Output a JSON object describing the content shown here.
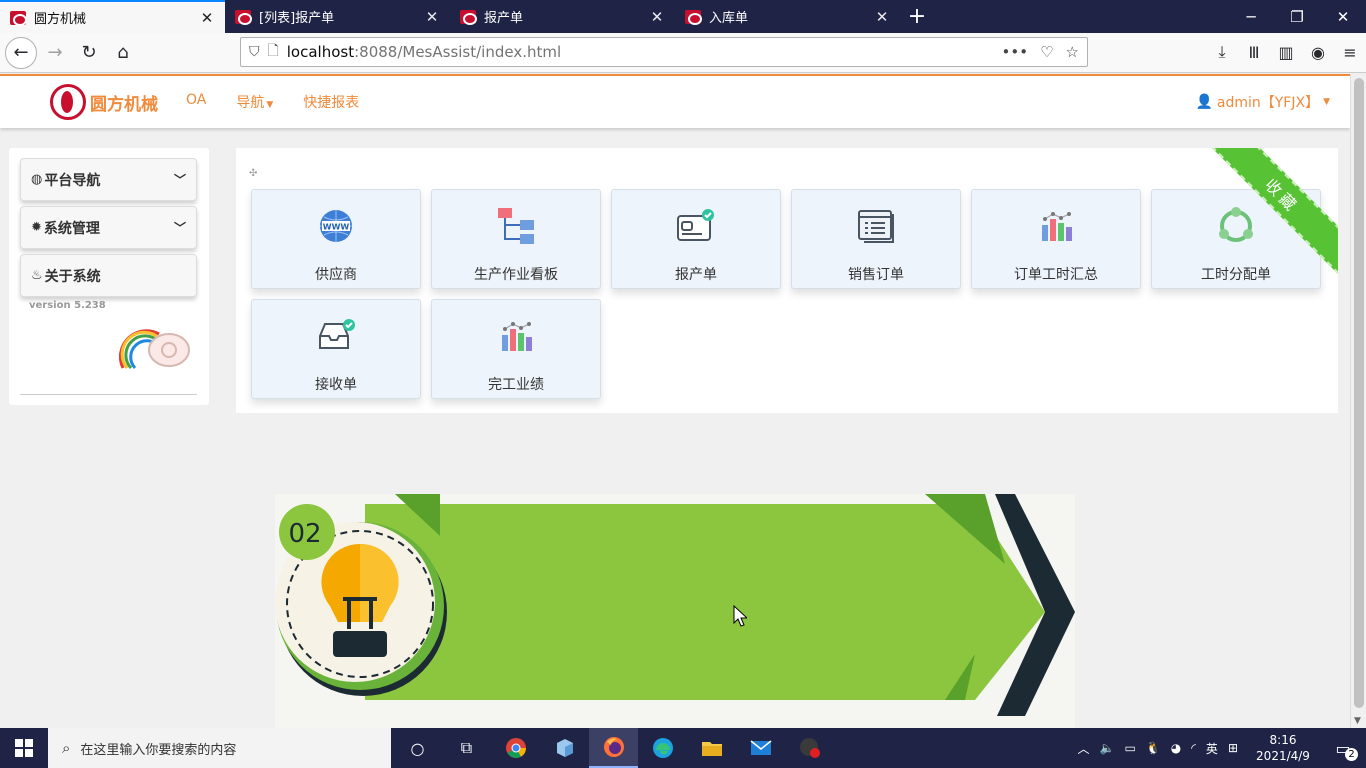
{
  "browser": {
    "tabs": [
      {
        "title": "圆方机械",
        "active": true
      },
      {
        "title": "[列表]报产单",
        "active": false
      },
      {
        "title": "报产单",
        "active": false
      },
      {
        "title": "入库单",
        "active": false
      }
    ],
    "url_host": "localhost",
    "url_path": ":8088/MesAssist/index.html"
  },
  "header": {
    "logo_text": "圆方机械",
    "menu": [
      {
        "label": "OA"
      },
      {
        "label": "导航"
      },
      {
        "label": "快捷报表"
      }
    ],
    "user": "admin【YFJX】"
  },
  "sidebar": {
    "items": [
      {
        "label": "平台导航",
        "icon": "globe-icon"
      },
      {
        "label": "系统管理",
        "icon": "gear-icon"
      },
      {
        "label": "关于系统",
        "icon": "fire-icon"
      }
    ],
    "version": "version 5.238"
  },
  "main": {
    "ribbon": "收藏",
    "tiles": [
      {
        "label": "供应商",
        "icon": "www-globe-icon"
      },
      {
        "label": "生产作业看板",
        "icon": "flowchart-icon"
      },
      {
        "label": "报产单",
        "icon": "card-check-icon"
      },
      {
        "label": "销售订单",
        "icon": "list-window-icon"
      },
      {
        "label": "订单工时汇总",
        "icon": "bar-chart-icon"
      },
      {
        "label": "工时分配单",
        "icon": "cycle-icon"
      },
      {
        "label": "接收单",
        "icon": "inbox-check-icon"
      },
      {
        "label": "完工业绩",
        "icon": "bar-chart-icon"
      }
    ]
  },
  "banner": {
    "number": "02"
  },
  "taskbar": {
    "search_placeholder": "在这里输入你要搜索的内容",
    "ime": "英",
    "time": "8:16",
    "date": "2021/4/9",
    "notifications": "2"
  }
}
